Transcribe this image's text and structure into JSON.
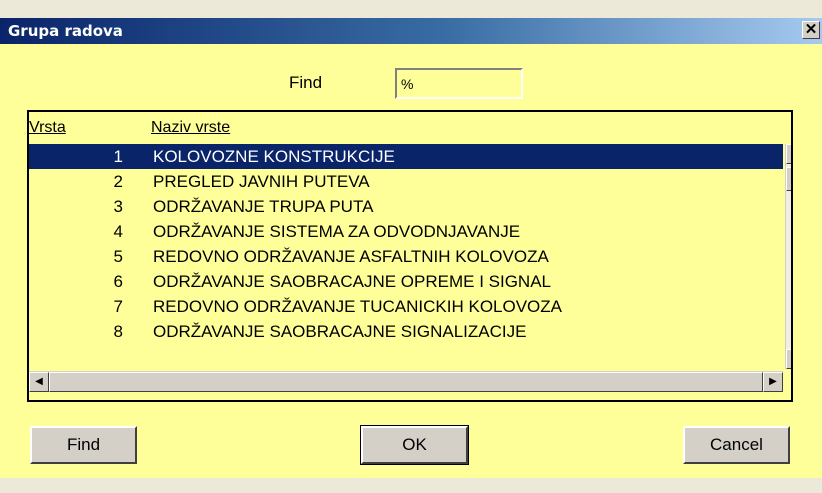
{
  "window": {
    "title": "Grupa radova",
    "close_glyph": "✕"
  },
  "search": {
    "label": "Find",
    "value": "%"
  },
  "grid": {
    "columns": [
      "Vrsta",
      "Naziv vrste"
    ],
    "rows": [
      {
        "vrsta": "1",
        "naziv": "KOLOVOZNE KONSTRUKCIJE",
        "selected": true
      },
      {
        "vrsta": "2",
        "naziv": "PREGLED JAVNIH PUTEVA"
      },
      {
        "vrsta": "3",
        "naziv": "ODRŽAVANJE TRUPA PUTA"
      },
      {
        "vrsta": "4",
        "naziv": "ODRŽAVANJE SISTEMA ZA ODVODNJAVANJE"
      },
      {
        "vrsta": "5",
        "naziv": "REDOVNO ODRŽAVANJE ASFALTNIH KOLOVOZA"
      },
      {
        "vrsta": "6",
        "naziv": "ODRŽAVANJE SAOBRACAJNE OPREME I SIGNAL"
      },
      {
        "vrsta": "7",
        "naziv": "REDOVNO ODRŽAVANJE TUCANICKIH KOLOVOZA"
      },
      {
        "vrsta": "8",
        "naziv": "ODRŽAVANJE SAOBRACAJNE SIGNALIZACIJE"
      }
    ]
  },
  "buttons": {
    "find": "Find",
    "ok": "OK",
    "cancel": "Cancel"
  },
  "icons": {
    "scroll_up": "scroll-up-arrow-icon",
    "scroll_down": "scroll-down-arrow-icon",
    "scroll_left": "scroll-left-arrow-icon",
    "scroll_right": "scroll-right-arrow-icon"
  },
  "colors": {
    "dialog_background": "#ffff99",
    "selection": "#0a246a",
    "titlebar_start": "#0a246a",
    "titlebar_end": "#a6caf0"
  }
}
